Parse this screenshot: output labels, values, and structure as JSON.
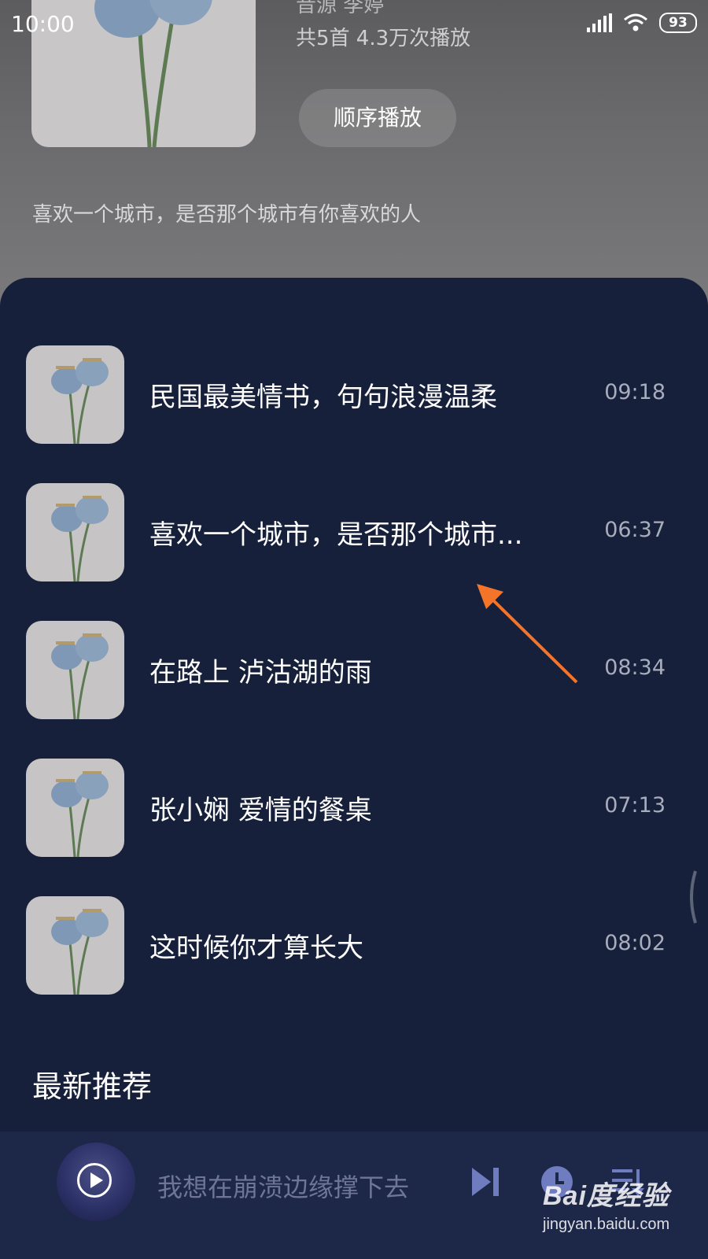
{
  "status_bar": {
    "time": "10:00",
    "battery": "93"
  },
  "album": {
    "author_line": "音源  李婷",
    "stats_line": "共5首   4.3万次播放",
    "play_order_label": "顺序播放",
    "description": "喜欢一个城市，是否那个城市有你喜欢的人"
  },
  "tracks": [
    {
      "title": "民国最美情书，句句浪漫温柔",
      "duration": "09:18"
    },
    {
      "title": "喜欢一个城市，是否那个城市...",
      "duration": "06:37"
    },
    {
      "title": "在路上 泸沽湖的雨",
      "duration": "08:34"
    },
    {
      "title": "张小娴 爱情的餐桌",
      "duration": "07:13"
    },
    {
      "title": "这时候你才算长大",
      "duration": "08:02"
    }
  ],
  "section": {
    "title": "最新推荐"
  },
  "player": {
    "now_playing": "我想在崩溃边缘撑下去"
  },
  "watermark": {
    "logo": "Bai度经验",
    "url": "jingyan.baidu.com"
  },
  "colors": {
    "background": "#17203a",
    "player_bar": "#1d2748",
    "arrow": "#f4742a"
  }
}
